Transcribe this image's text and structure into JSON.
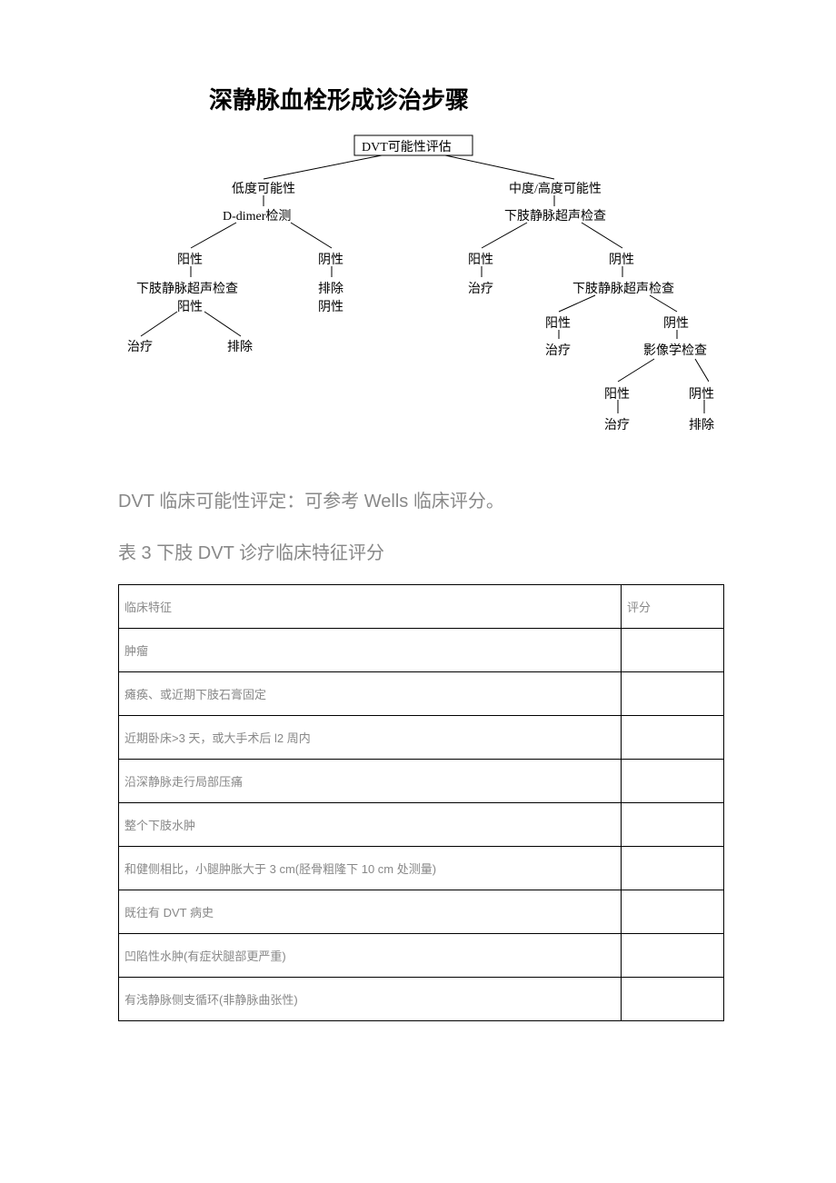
{
  "title": "深静脉血栓形成诊治步骤",
  "diagram": {
    "root": "DVT可能性评估",
    "left": {
      "label": "低度可能性",
      "test": "D-dimer检测",
      "pos": "阳性",
      "neg": "阴性",
      "pos_next": "下肢静脉超声检查",
      "neg_next": "排除",
      "pos_pos": "阳性",
      "pos_neg": "阴性",
      "pos_pos_a": "治疗",
      "pos_pos_b": "排除"
    },
    "right": {
      "label": "中度/高度可能性",
      "test": "下肢静脉超声检查",
      "pos": "阳性",
      "neg": "阴性",
      "pos_next": "治疗",
      "neg_next": "下肢静脉超声检查",
      "neg_pos": "阳性",
      "neg_neg": "阴性",
      "neg_pos_next": "治疗",
      "neg_neg_next": "影像学检查",
      "img_pos": "阳性",
      "img_neg": "阴性",
      "img_pos_next": "治疗",
      "img_neg_next": "排除"
    }
  },
  "paragraph": "DVT 临床可能性评定：可参考 Wells 临床评分。",
  "table_caption": "表 3  下肢 DVT 诊疗临床特征评分",
  "table": {
    "header_feature": "临床特征",
    "header_score": "评分",
    "rows": [
      {
        "feature": "肿瘤",
        "score": ""
      },
      {
        "feature": "瘫痪、或近期下肢石膏固定",
        "score": ""
      },
      {
        "feature": "近期卧床>3 天，或大手术后 l2 周内",
        "score": ""
      },
      {
        "feature": "沿深静脉走行局部压痛",
        "score": ""
      },
      {
        "feature": "整个下肢水肿",
        "score": ""
      },
      {
        "feature": "和健侧相比，小腿肿胀大于 3 cm(胫骨粗隆下 10 cm 处测量)",
        "score": ""
      },
      {
        "feature": "既往有 DVT 病史",
        "score": ""
      },
      {
        "feature": "凹陷性水肿(有症状腿部更严重)",
        "score": ""
      },
      {
        "feature": "有浅静脉侧支循环(非静脉曲张性)",
        "score": ""
      }
    ]
  }
}
